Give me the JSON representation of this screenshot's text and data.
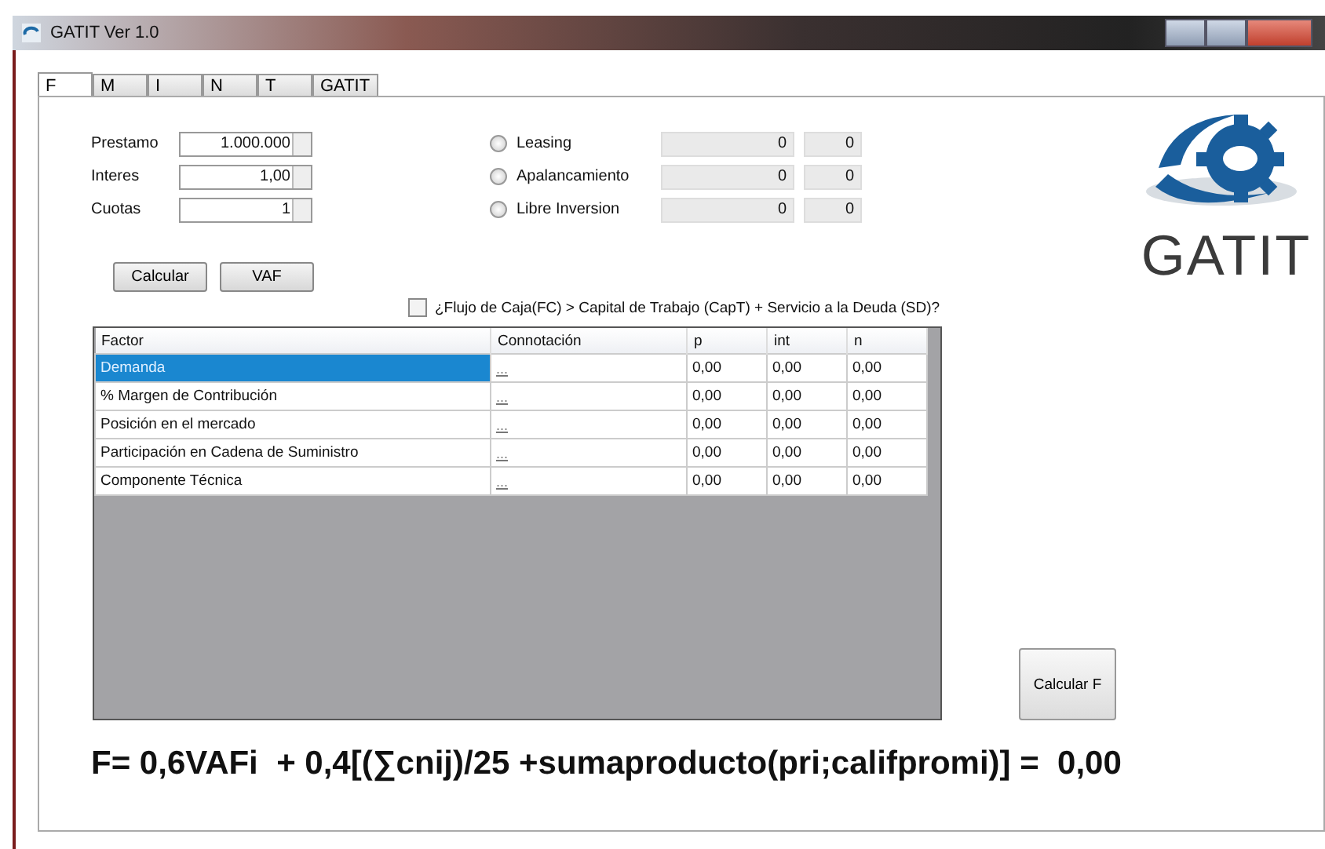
{
  "window": {
    "title": "GATIT Ver 1.0"
  },
  "tabs": [
    {
      "label": "F",
      "selected": true
    },
    {
      "label": "M",
      "selected": false
    },
    {
      "label": "I",
      "selected": false
    },
    {
      "label": "N",
      "selected": false
    },
    {
      "label": "T",
      "selected": false
    },
    {
      "label": "GATIT",
      "selected": false
    }
  ],
  "inputs": [
    {
      "label": "Prestamo",
      "value": "1.000.000"
    },
    {
      "label": "Interes",
      "value": "1,00"
    },
    {
      "label": "Cuotas",
      "value": "1"
    }
  ],
  "options": [
    {
      "label": "Leasing",
      "selected": false,
      "values": [
        "0",
        "0"
      ]
    },
    {
      "label": "Apalancamiento",
      "selected": false,
      "values": [
        "0",
        "0"
      ]
    },
    {
      "label": "Libre Inversion",
      "selected": false,
      "values": [
        "0",
        "0"
      ]
    }
  ],
  "buttons": [
    "Calcular",
    "VAF"
  ],
  "condition": {
    "label": "¿Flujo de Caja(FC) > Capital de Trabajo (CapT) + Servicio a la Deuda (SD)?",
    "checked": false
  },
  "logo": {
    "text": "GATIT"
  },
  "table": {
    "columns": [
      "Factor",
      "Connotación",
      "p",
      "int",
      "n"
    ],
    "rows": [
      {
        "cells": [
          "Demanda",
          "...",
          "0,00",
          "0,00",
          "0,00"
        ],
        "selected": true
      },
      {
        "cells": [
          "% Margen de Contribución",
          "...",
          "0,00",
          "0,00",
          "0,00"
        ],
        "selected": false
      },
      {
        "cells": [
          "Posición en el mercado",
          "...",
          "0,00",
          "0,00",
          "0,00"
        ],
        "selected": false
      },
      {
        "cells": [
          "Participación en Cadena de Suministro",
          "...",
          "0,00",
          "0,00",
          "0,00"
        ],
        "selected": false
      },
      {
        "cells": [
          "Componente Técnica",
          "...",
          "0,00",
          "0,00",
          "0,00"
        ],
        "selected": false
      }
    ]
  },
  "calc_button": "Calcular F",
  "formula": "F= 0,6VAFi  + 0,4[(∑cnij)/25 +sumaproducto(pri;califpromi)] =  0,00"
}
